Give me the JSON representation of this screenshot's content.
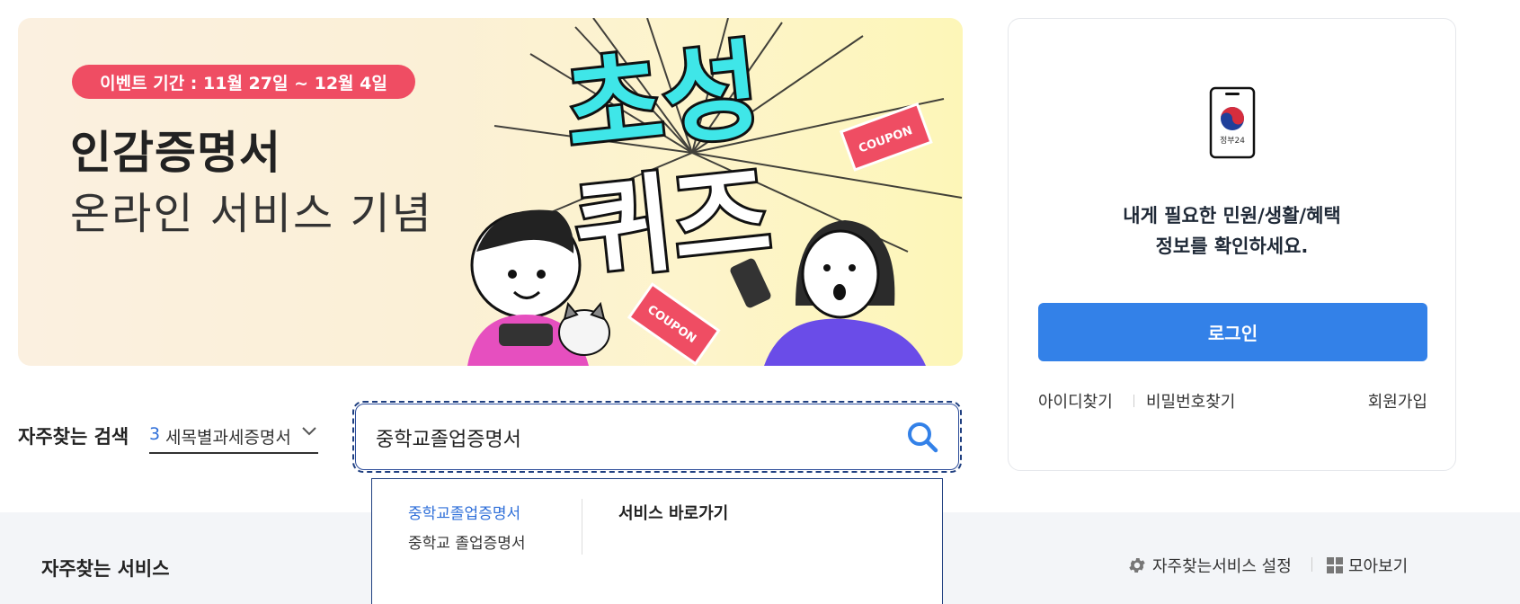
{
  "banner": {
    "event_period": "이벤트 기간 : 11월 27일 ~ 12월 4일",
    "title": "인감증명서",
    "subtitle": "온라인 서비스 기념",
    "quiz_title": "초성퀴즈",
    "coupon_label": "COUPON"
  },
  "login_card": {
    "logo_text": "정부24",
    "message_line1": "내게 필요한 민원/생활/혜택",
    "message_line2": "정보를 확인하세요.",
    "login_button": "로그인",
    "find_id": "아이디찾기",
    "find_password": "비밀번호찾기",
    "signup": "회원가입"
  },
  "search": {
    "fav_label": "자주찾는 검색",
    "fav_number": "3",
    "fav_selected": "세목별과세증명서",
    "query": "중학교졸업증명서"
  },
  "autocomplete": {
    "suggestions": [
      "중학교졸업증명서",
      "중학교 졸업증명서"
    ],
    "shortcut_title": "서비스 바로가기"
  },
  "fav_services": {
    "title": "자주찾는 서비스",
    "settings_label": "자주찾는서비스 설정",
    "view_all_label": "모아보기"
  },
  "colors": {
    "primary_blue": "#3381e8",
    "event_pink": "#ef4d63",
    "quiz_cyan": "#3fe6e8",
    "link_blue": "#2f6fd9"
  }
}
